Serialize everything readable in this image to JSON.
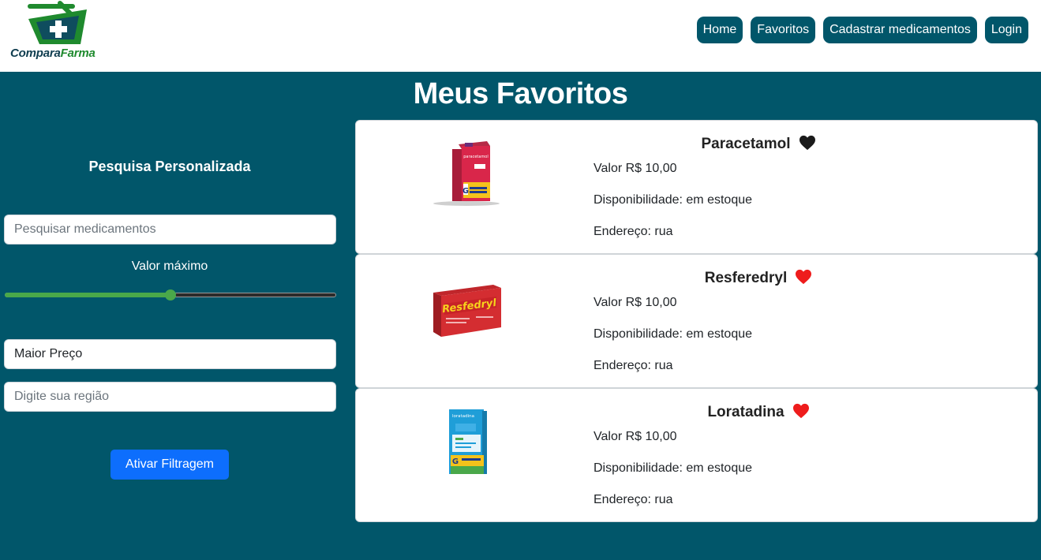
{
  "brand": {
    "part1": "Compara",
    "part2": "Farma"
  },
  "nav": [
    {
      "label": "Home"
    },
    {
      "label": "Favoritos"
    },
    {
      "label": "Cadastrar medicamentos"
    },
    {
      "label": "Login"
    }
  ],
  "page": {
    "title": "Meus Favoritos"
  },
  "sidebar": {
    "heading": "Pesquisa Personalizada",
    "search_placeholder": "Pesquisar medicamentos",
    "range_label": "Valor máximo",
    "range_level": 0.5,
    "order_value": "Maior Preço",
    "region_placeholder": "Digite sua região",
    "filter_button": "Ativar Filtragem"
  },
  "products": [
    {
      "name": "Paracetamol",
      "price": "Valor R$ 10,00",
      "availability": "Disponibilidade: em estoque",
      "address": "Endereço: rua",
      "heart_color": "#1a1a1a",
      "box_text": "paracetamol"
    },
    {
      "name": "Resferedryl",
      "price": "Valor R$ 10,00",
      "availability": "Disponibilidade: em estoque",
      "address": "Endereço: rua",
      "heart_color": "#ee1c1c",
      "box_text": "Resfedryl"
    },
    {
      "name": "Loratadina",
      "price": "Valor R$ 10,00",
      "availability": "Disponibilidade: em estoque",
      "address": "Endereço: rua",
      "heart_color": "#ee1c1c",
      "box_text": "loratadina"
    }
  ],
  "colors": {
    "primary": "#01566a",
    "accent_button": "#0d6efd",
    "slider": "#4aa84a"
  }
}
